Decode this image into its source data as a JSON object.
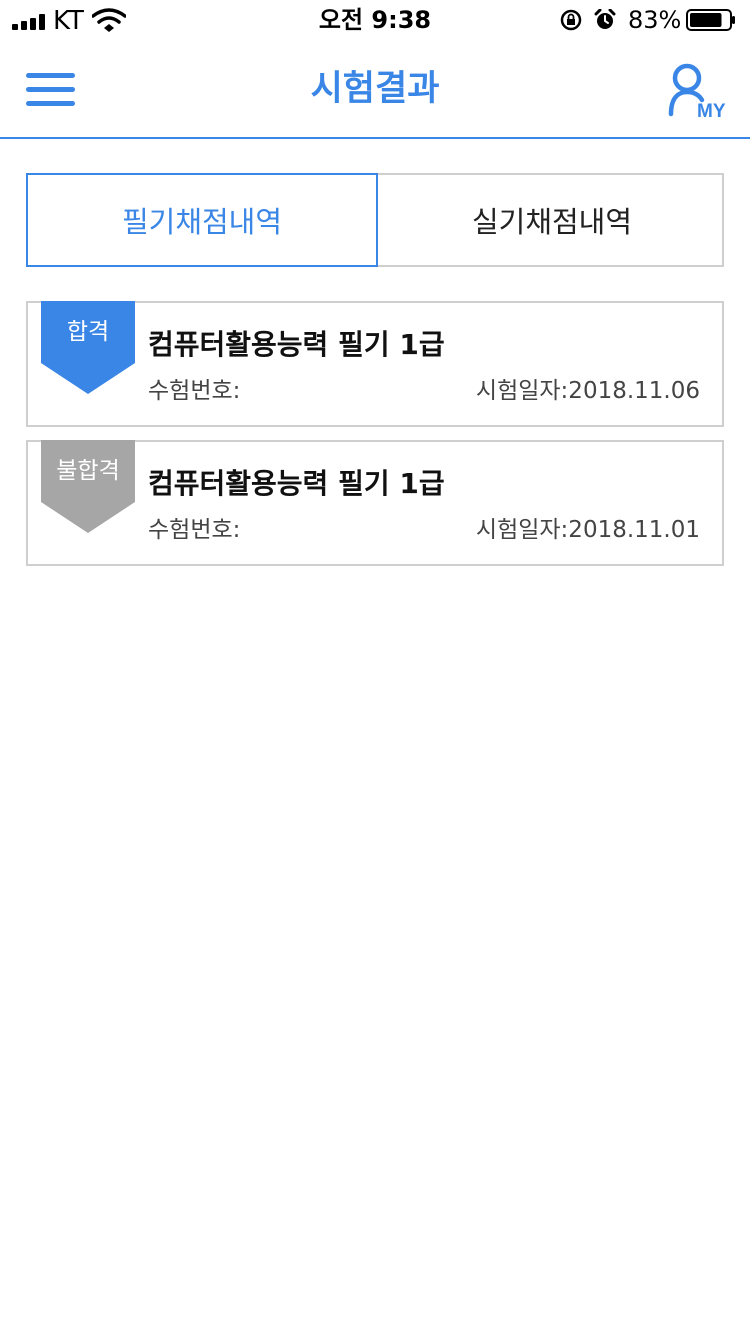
{
  "status_bar": {
    "carrier": "KT",
    "time": "오전 9:38",
    "battery_percent": "83%",
    "battery_level": 0.83,
    "icons": [
      "signal-icon",
      "wifi-icon",
      "rotation-lock-icon",
      "alarm-icon",
      "battery-icon"
    ]
  },
  "nav": {
    "title": "시험결과",
    "menu_icon": "hamburger-menu-icon",
    "my_icon": "my-profile-icon",
    "my_label": "MY",
    "accent_color": "#3a86e6"
  },
  "tabs": [
    {
      "label": "필기채점내역",
      "active": true
    },
    {
      "label": "실기채점내역",
      "active": false
    }
  ],
  "results": [
    {
      "status": "합격",
      "status_color": "#3a86e6",
      "title": "컴퓨터활용능력 필기 1급",
      "exam_number_label": "수험번호:",
      "exam_date": "시험일자:2018.11.06"
    },
    {
      "status": "불합격",
      "status_color": "#a6a6a6",
      "title": "컴퓨터활용능력 필기 1급",
      "exam_number_label": "수험번호:",
      "exam_date": "시험일자:2018.11.01"
    }
  ]
}
